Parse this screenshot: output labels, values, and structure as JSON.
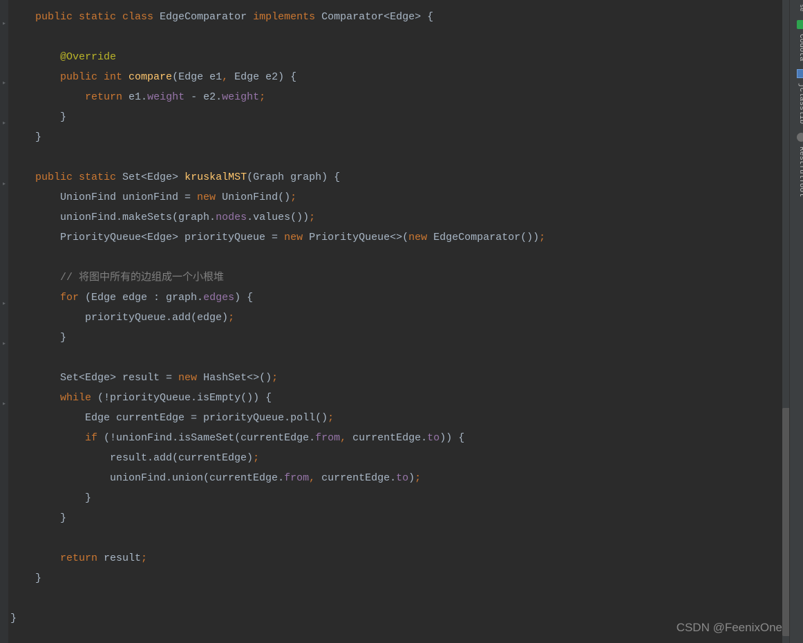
{
  "sidebar": {
    "tabs": [
      {
        "label": "Codota",
        "icon": "codota"
      },
      {
        "label": "jclasslib",
        "icon": "jclasslib"
      },
      {
        "label": "RestfulTool",
        "icon": "restful"
      }
    ],
    "partial_top": "se"
  },
  "watermark": "CSDN @FeenixOne",
  "code": {
    "lines": [
      [
        {
          "t": "    ",
          "c": "kw-text"
        },
        {
          "t": "public static class ",
          "c": "kw-orange"
        },
        {
          "t": "EdgeComparator ",
          "c": "kw-text"
        },
        {
          "t": "implements ",
          "c": "kw-orange"
        },
        {
          "t": "Comparator<Edge> {",
          "c": "kw-text"
        }
      ],
      [],
      [
        {
          "t": "        ",
          "c": "kw-text"
        },
        {
          "t": "@Override",
          "c": "kw-olive"
        }
      ],
      [
        {
          "t": "        ",
          "c": "kw-text"
        },
        {
          "t": "public int ",
          "c": "kw-orange"
        },
        {
          "t": "compare",
          "c": "kw-yellow"
        },
        {
          "t": "(Edge e1",
          "c": "kw-text"
        },
        {
          "t": ", ",
          "c": "kw-orange"
        },
        {
          "t": "Edge e2) {",
          "c": "kw-text"
        }
      ],
      [
        {
          "t": "            ",
          "c": "kw-text"
        },
        {
          "t": "return ",
          "c": "kw-orange"
        },
        {
          "t": "e1.",
          "c": "kw-text"
        },
        {
          "t": "weight ",
          "c": "kw-purple"
        },
        {
          "t": "- e2.",
          "c": "kw-text"
        },
        {
          "t": "weight",
          "c": "kw-purple"
        },
        {
          "t": ";",
          "c": "kw-orange"
        }
      ],
      [
        {
          "t": "        }",
          "c": "kw-text"
        }
      ],
      [
        {
          "t": "    }",
          "c": "kw-text"
        }
      ],
      [],
      [
        {
          "t": "    ",
          "c": "kw-text"
        },
        {
          "t": "public static ",
          "c": "kw-orange"
        },
        {
          "t": "Set<Edge> ",
          "c": "kw-text"
        },
        {
          "t": "kruskalMST",
          "c": "kw-yellow"
        },
        {
          "t": "(Graph graph) {",
          "c": "kw-text"
        }
      ],
      [
        {
          "t": "        UnionFind unionFind = ",
          "c": "kw-text"
        },
        {
          "t": "new ",
          "c": "kw-orange"
        },
        {
          "t": "UnionFind()",
          "c": "kw-text"
        },
        {
          "t": ";",
          "c": "kw-orange"
        }
      ],
      [
        {
          "t": "        unionFind.makeSets(graph.",
          "c": "kw-text"
        },
        {
          "t": "nodes",
          "c": "kw-purple"
        },
        {
          "t": ".values())",
          "c": "kw-text"
        },
        {
          "t": ";",
          "c": "kw-orange"
        }
      ],
      [
        {
          "t": "        PriorityQueue<Edge> priorityQueue = ",
          "c": "kw-text"
        },
        {
          "t": "new ",
          "c": "kw-orange"
        },
        {
          "t": "PriorityQueue<>(",
          "c": "kw-text"
        },
        {
          "t": "new ",
          "c": "kw-orange"
        },
        {
          "t": "EdgeComparator())",
          "c": "kw-text"
        },
        {
          "t": ";",
          "c": "kw-orange"
        }
      ],
      [],
      [
        {
          "t": "        ",
          "c": "kw-text"
        },
        {
          "t": "// 将图中所有的边组成一个小根堆",
          "c": "kw-gray"
        }
      ],
      [
        {
          "t": "        ",
          "c": "kw-text"
        },
        {
          "t": "for ",
          "c": "kw-orange"
        },
        {
          "t": "(Edge edge : graph.",
          "c": "kw-text"
        },
        {
          "t": "edges",
          "c": "kw-purple"
        },
        {
          "t": ") {",
          "c": "kw-text"
        }
      ],
      [
        {
          "t": "            priorityQueue.add(edge)",
          "c": "kw-text"
        },
        {
          "t": ";",
          "c": "kw-orange"
        }
      ],
      [
        {
          "t": "        }",
          "c": "kw-text"
        }
      ],
      [],
      [
        {
          "t": "        Set<Edge> result = ",
          "c": "kw-text"
        },
        {
          "t": "new ",
          "c": "kw-orange"
        },
        {
          "t": "HashSet<>()",
          "c": "kw-text"
        },
        {
          "t": ";",
          "c": "kw-orange"
        }
      ],
      [
        {
          "t": "        ",
          "c": "kw-text"
        },
        {
          "t": "while ",
          "c": "kw-orange"
        },
        {
          "t": "(!priorityQueue.isEmpty()) {",
          "c": "kw-text"
        }
      ],
      [
        {
          "t": "            Edge currentEdge = priorityQueue.poll()",
          "c": "kw-text"
        },
        {
          "t": ";",
          "c": "kw-orange"
        }
      ],
      [
        {
          "t": "            ",
          "c": "kw-text"
        },
        {
          "t": "if ",
          "c": "kw-orange"
        },
        {
          "t": "(!unionFind.isSameSet(currentEdge.",
          "c": "kw-text"
        },
        {
          "t": "from",
          "c": "kw-purple"
        },
        {
          "t": ", ",
          "c": "kw-orange"
        },
        {
          "t": "currentEdge.",
          "c": "kw-text"
        },
        {
          "t": "to",
          "c": "kw-purple"
        },
        {
          "t": ")) {",
          "c": "kw-text"
        }
      ],
      [
        {
          "t": "                result.add(currentEdge)",
          "c": "kw-text"
        },
        {
          "t": ";",
          "c": "kw-orange"
        }
      ],
      [
        {
          "t": "                unionFind.union(currentEdge.",
          "c": "kw-text"
        },
        {
          "t": "from",
          "c": "kw-purple"
        },
        {
          "t": ", ",
          "c": "kw-orange"
        },
        {
          "t": "currentEdge.",
          "c": "kw-text"
        },
        {
          "t": "to",
          "c": "kw-purple"
        },
        {
          "t": ")",
          "c": "kw-text"
        },
        {
          "t": ";",
          "c": "kw-orange"
        }
      ],
      [
        {
          "t": "            }",
          "c": "kw-text"
        }
      ],
      [
        {
          "t": "        }",
          "c": "kw-text"
        }
      ],
      [],
      [
        {
          "t": "        ",
          "c": "kw-text"
        },
        {
          "t": "return ",
          "c": "kw-orange"
        },
        {
          "t": "result",
          "c": "kw-text"
        },
        {
          "t": ";",
          "c": "kw-orange"
        }
      ],
      [
        {
          "t": "    }",
          "c": "kw-text"
        }
      ],
      [],
      [
        {
          "t": "}",
          "c": "kw-text"
        }
      ]
    ]
  }
}
